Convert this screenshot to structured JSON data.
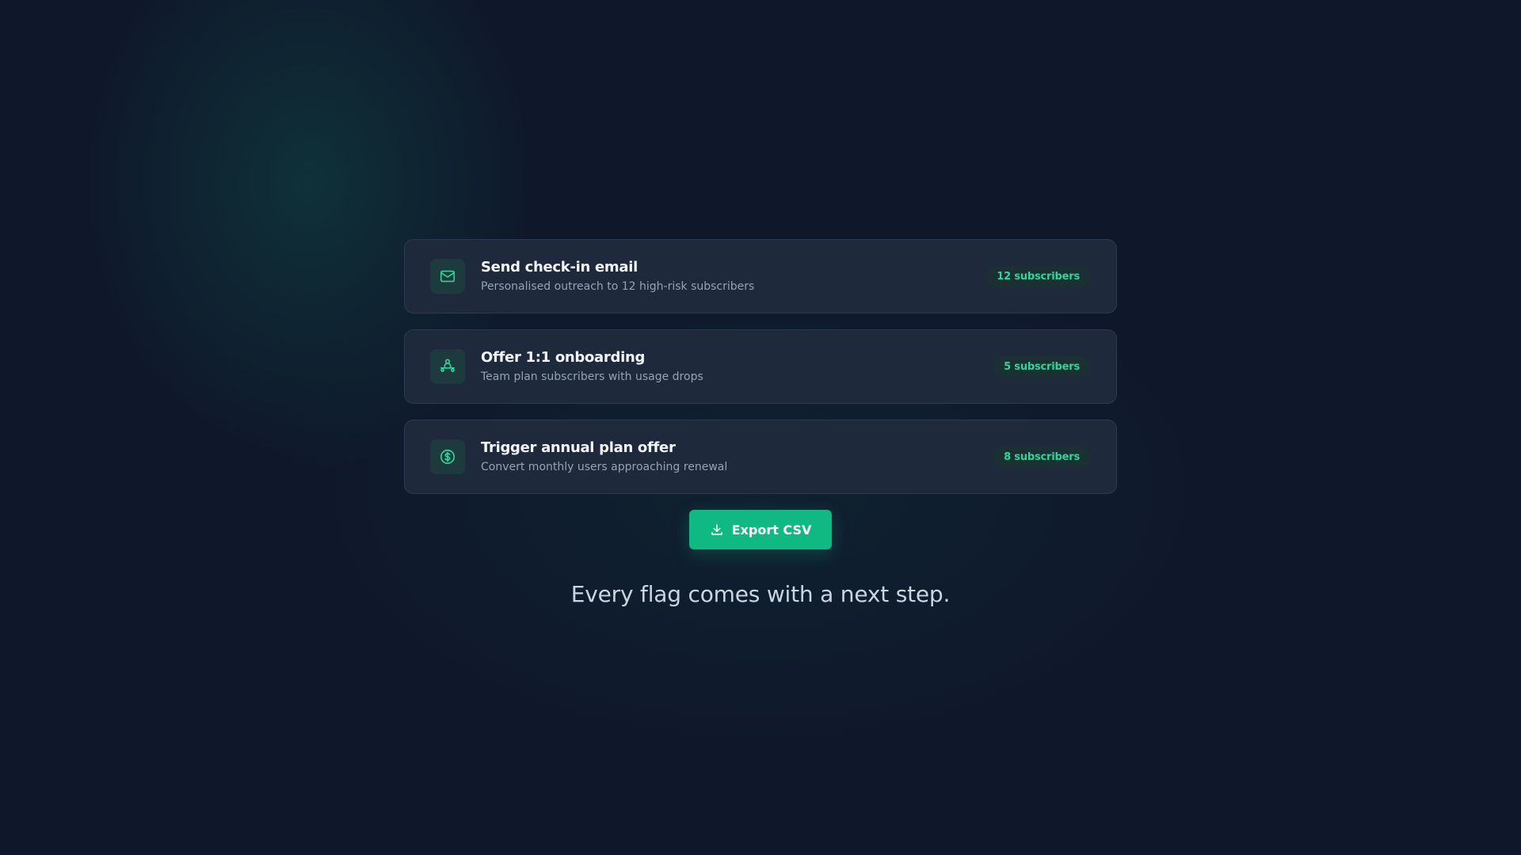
{
  "actions": [
    {
      "icon": "mail-icon",
      "title": "Send check-in email",
      "subtitle": "Personalised outreach to 12 high-risk subscribers",
      "badge": "12 subscribers"
    },
    {
      "icon": "person-onboarding-icon",
      "title": "Offer 1:1 onboarding",
      "subtitle": "Team plan subscribers with usage drops",
      "badge": "5 subscribers"
    },
    {
      "icon": "dollar-circle-icon",
      "title": "Trigger annual plan offer",
      "subtitle": "Convert monthly users approaching renewal",
      "badge": "8 subscribers"
    }
  ],
  "export_button": {
    "icon": "download-icon",
    "label": "Export CSV"
  },
  "tagline": "Every flag comes with a next step.",
  "colors": {
    "background": "#0f172a",
    "card": "#1e293b",
    "accent": "#10b981",
    "badge_text": "#34d399"
  }
}
